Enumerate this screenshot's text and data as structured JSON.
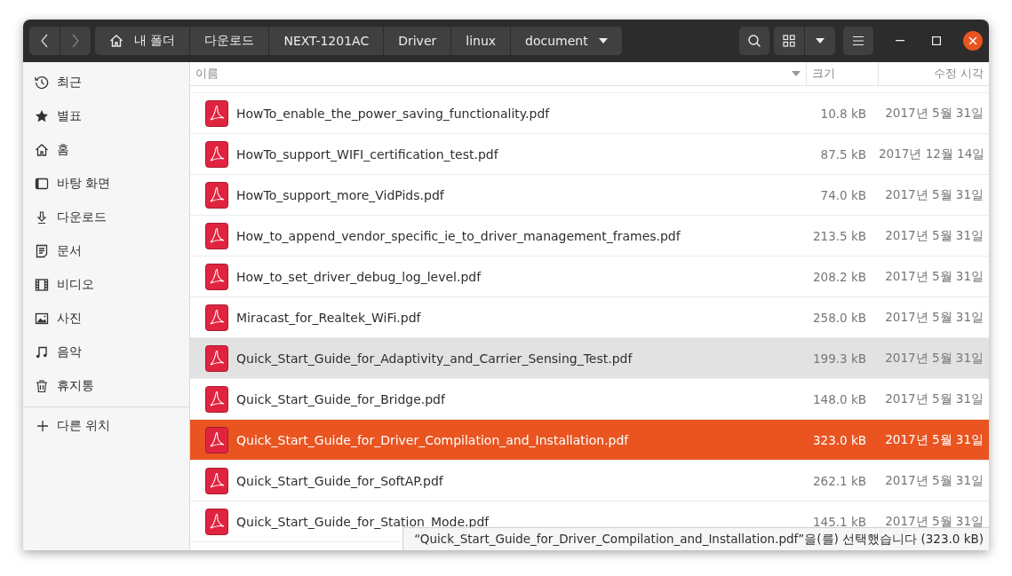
{
  "path_bar": [
    {
      "label": "내 폴더",
      "kind": "home"
    },
    {
      "label": "다운로드",
      "kind": "plain"
    },
    {
      "label": "NEXT-1201AC",
      "kind": "plain"
    },
    {
      "label": "Driver",
      "kind": "plain"
    },
    {
      "label": "linux",
      "kind": "plain"
    },
    {
      "label": "document",
      "kind": "menu"
    }
  ],
  "sidebar": {
    "items": [
      {
        "label": "최근",
        "kind": "recent"
      },
      {
        "label": "별표",
        "kind": "star"
      },
      {
        "label": "홈",
        "kind": "home"
      },
      {
        "label": "바탕 화면",
        "kind": "desktop"
      },
      {
        "label": "다운로드",
        "kind": "download"
      },
      {
        "label": "문서",
        "kind": "document"
      },
      {
        "label": "비디오",
        "kind": "video"
      },
      {
        "label": "사진",
        "kind": "photo"
      },
      {
        "label": "음악",
        "kind": "music"
      },
      {
        "label": "휴지통",
        "kind": "trash"
      }
    ],
    "other": {
      "label": "다른 위치"
    }
  },
  "table": {
    "columns": [
      "이름",
      "크기",
      "수정 시각"
    ],
    "rows": [
      {
        "name": "HowTo_enable_the_power_saving_functionality.pdf",
        "size": "10.8 kB",
        "modified": "2017년 5월 31일",
        "selected": false,
        "hovered": false
      },
      {
        "name": "HowTo_support_WIFI_certification_test.pdf",
        "size": "87.5 kB",
        "modified": "2017년 12월 14일",
        "selected": false,
        "hovered": false
      },
      {
        "name": "HowTo_support_more_VidPids.pdf",
        "size": "74.0 kB",
        "modified": "2017년 5월 31일",
        "selected": false,
        "hovered": false
      },
      {
        "name": "How_to_append_vendor_specific_ie_to_driver_management_frames.pdf",
        "size": "213.5 kB",
        "modified": "2017년 5월 31일",
        "selected": false,
        "hovered": false
      },
      {
        "name": "How_to_set_driver_debug_log_level.pdf",
        "size": "208.2 kB",
        "modified": "2017년 5월 31일",
        "selected": false,
        "hovered": false
      },
      {
        "name": "Miracast_for_Realtek_WiFi.pdf",
        "size": "258.0 kB",
        "modified": "2017년 5월 31일",
        "selected": false,
        "hovered": false
      },
      {
        "name": "Quick_Start_Guide_for_Adaptivity_and_Carrier_Sensing_Test.pdf",
        "size": "199.3 kB",
        "modified": "2017년 5월 31일",
        "selected": false,
        "hovered": true
      },
      {
        "name": "Quick_Start_Guide_for_Bridge.pdf",
        "size": "148.0 kB",
        "modified": "2017년 5월 31일",
        "selected": false,
        "hovered": false
      },
      {
        "name": "Quick_Start_Guide_for_Driver_Compilation_and_Installation.pdf",
        "size": "323.0 kB",
        "modified": "2017년 5월 31일",
        "selected": true,
        "hovered": false
      },
      {
        "name": "Quick_Start_Guide_for_SoftAP.pdf",
        "size": "262.1 kB",
        "modified": "2017년 5월 31일",
        "selected": false,
        "hovered": false
      },
      {
        "name": "Quick_Start_Guide_for_Station_Mode.pdf",
        "size": "145.1 kB",
        "modified": "2017년 5월 31일",
        "selected": false,
        "hovered": false
      }
    ]
  },
  "status": "“Quick_Start_Guide_for_Driver_Compilation_and_Installation.pdf”을(를) 선택했습니다 (323.0 kB)"
}
